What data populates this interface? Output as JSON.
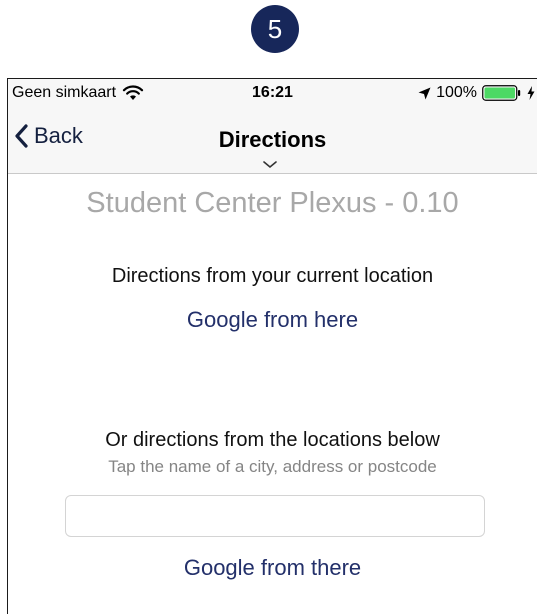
{
  "step_badge": "5",
  "status_bar": {
    "carrier": "Geen simkaart",
    "time": "16:21",
    "battery": "100%"
  },
  "nav": {
    "back_label": "Back",
    "title": "Directions"
  },
  "content": {
    "place_title": "Student Center Plexus - 0.10",
    "current_location_label": "Directions from your current location",
    "google_here_label": "Google from here",
    "other_location_label": "Or directions from the locations below",
    "hint": "Tap the name of a city, address or postcode",
    "input_value": "",
    "google_there_label": "Google from there"
  },
  "colors": {
    "badge": "#17275a",
    "link": "#23306a",
    "title_gray": "#a8a8a8",
    "battery_green": "#4cd964"
  },
  "icons": [
    "wifi-icon",
    "location-arrow-icon",
    "battery-icon",
    "charging-bolt-icon",
    "back-chevron-icon",
    "chevron-down-icon"
  ]
}
